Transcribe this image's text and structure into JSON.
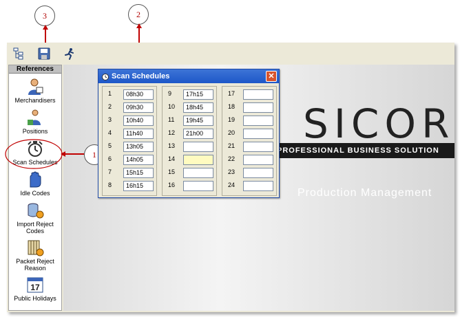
{
  "callouts": [
    "1",
    "2",
    "3"
  ],
  "sidebar": {
    "header": "References",
    "items": [
      {
        "label": "Merchandisers",
        "icon": "merchandisers-icon"
      },
      {
        "label": "Positions",
        "icon": "positions-icon"
      },
      {
        "label": "Scan Schedules",
        "icon": "scan-schedules-icon"
      },
      {
        "label": "Idle Codes",
        "icon": "idle-codes-icon"
      },
      {
        "label": "Import Reject Codes",
        "icon": "import-reject-codes-icon"
      },
      {
        "label": "Packet Reject Reason",
        "icon": "packet-reject-reason-icon"
      },
      {
        "label": "Public Holidays",
        "icon": "public-holidays-icon"
      }
    ]
  },
  "calendar_icon_day": "17",
  "background": {
    "logo": "SICOR",
    "banner": "PROFESSIONAL BUSINESS SOLUTION",
    "tagline": "Production Management"
  },
  "dialog": {
    "title": "Scan Schedules",
    "close": "✕",
    "slots": [
      {
        "n": "1",
        "v": "08h30"
      },
      {
        "n": "2",
        "v": "09h30"
      },
      {
        "n": "3",
        "v": "10h40"
      },
      {
        "n": "4",
        "v": "11h40"
      },
      {
        "n": "5",
        "v": "13h05"
      },
      {
        "n": "6",
        "v": "14h05"
      },
      {
        "n": "7",
        "v": "15h15"
      },
      {
        "n": "8",
        "v": "16h15"
      },
      {
        "n": "9",
        "v": "17h15"
      },
      {
        "n": "10",
        "v": "18h45"
      },
      {
        "n": "11",
        "v": "19h45"
      },
      {
        "n": "12",
        "v": "21h00"
      },
      {
        "n": "13",
        "v": ""
      },
      {
        "n": "14",
        "v": ""
      },
      {
        "n": "15",
        "v": ""
      },
      {
        "n": "16",
        "v": ""
      },
      {
        "n": "17",
        "v": ""
      },
      {
        "n": "18",
        "v": ""
      },
      {
        "n": "19",
        "v": ""
      },
      {
        "n": "20",
        "v": ""
      },
      {
        "n": "21",
        "v": ""
      },
      {
        "n": "22",
        "v": ""
      },
      {
        "n": "23",
        "v": ""
      },
      {
        "n": "24",
        "v": ""
      }
    ]
  },
  "colors": {
    "title_bar": "#1d57c8",
    "annotation": "#c00000",
    "focus_field": "#fffbc0"
  }
}
